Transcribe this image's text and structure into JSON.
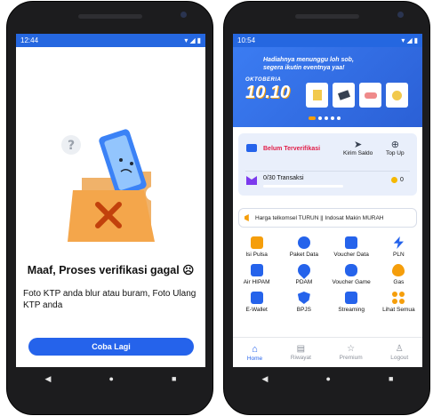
{
  "left": {
    "status": {
      "time": "12:44"
    },
    "title": "Maaf, Proses verifikasi gagal",
    "message": "Foto KTP anda blur atau buram, Foto Ulang KTP anda",
    "retry_label": "Coba Lagi",
    "title_emoji": "☹"
  },
  "right": {
    "status": {
      "time": "10:54"
    },
    "banner": {
      "line1": "Hadiahnya menunggu loh sob,",
      "line2": "segera ikutin eventnya yaa!",
      "event_small": "OKTOBERIA",
      "event_big": "10.10"
    },
    "account": {
      "status": "Belum Terverifikasi",
      "send_label": "Kirim Saldo",
      "topup_label": "Top Up",
      "transactions": "0/30 Transaksi",
      "coins": "0"
    },
    "promo": "Harga telkomsel TURUN || Indosat Makin MURAH",
    "menu": [
      {
        "label": "Isi Pulsa",
        "icon": "phone-icon",
        "color": "#f59e0b"
      },
      {
        "label": "Paket Data",
        "icon": "globe-icon",
        "color": "#2563eb"
      },
      {
        "label": "Voucher Data",
        "icon": "ticket-icon",
        "color": "#2563eb"
      },
      {
        "label": "PLN",
        "icon": "lightning-icon",
        "color": "#2563eb"
      },
      {
        "label": "Air HIPAM",
        "icon": "faucet-icon",
        "color": "#2563eb"
      },
      {
        "label": "PDAM",
        "icon": "water-drop-icon",
        "color": "#2563eb"
      },
      {
        "label": "Voucher Game",
        "icon": "gamepad-icon",
        "color": "#2563eb"
      },
      {
        "label": "Gas",
        "icon": "flame-icon",
        "color": "#f59e0b"
      },
      {
        "label": "E-Wallet",
        "icon": "wallet-icon",
        "color": "#2563eb"
      },
      {
        "label": "BPJS",
        "icon": "shield-icon",
        "color": "#2563eb"
      },
      {
        "label": "Streaming",
        "icon": "tv-icon",
        "color": "#2563eb"
      },
      {
        "label": "Lihat Semua",
        "icon": "dots-grid-icon",
        "color": "#f59e0b"
      }
    ],
    "nav": [
      {
        "label": "Home",
        "icon": "home-icon"
      },
      {
        "label": "Riwayat",
        "icon": "receipt-icon"
      },
      {
        "label": "Premium",
        "icon": "star-icon"
      },
      {
        "label": "Logout",
        "icon": "user-icon"
      }
    ]
  },
  "colors": {
    "primary": "#2563eb",
    "warning_red": "#e11d48",
    "accent_orange": "#f59e0b"
  }
}
